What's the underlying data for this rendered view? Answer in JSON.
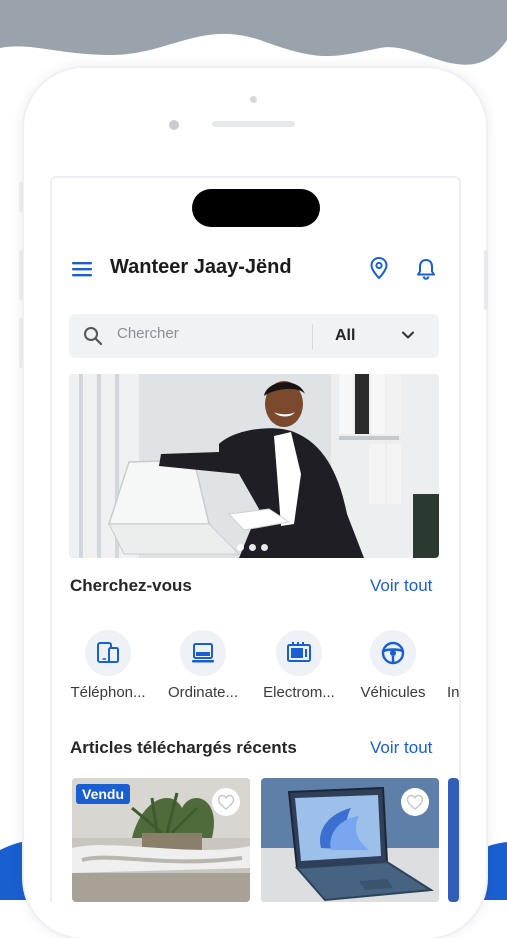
{
  "app": {
    "title": "Wanteer Jaay-Jënd",
    "accent_color": "#1a5fd0"
  },
  "header": {
    "menu_icon": "menu-icon",
    "location_icon": "map-pin-icon",
    "notification_icon": "bell-icon"
  },
  "search": {
    "placeholder": "Chercher",
    "category_select": "All"
  },
  "banner": {
    "slide_count": 3,
    "active_slide": 1
  },
  "categories_section": {
    "title": "Cherchez-vous",
    "link": "Voir tout",
    "items": [
      {
        "label": "Téléphon...",
        "icon": "phone-tablet-icon"
      },
      {
        "label": "Ordinate...",
        "icon": "laptop-icon"
      },
      {
        "label": "Electrom...",
        "icon": "microwave-icon"
      },
      {
        "label": "Véhicules",
        "icon": "steering-wheel-icon"
      },
      {
        "label": "In",
        "icon": ""
      }
    ]
  },
  "recent_section": {
    "title": "Articles téléchargés récents",
    "link": "Voir tout",
    "items": [
      {
        "badge": "Vendu",
        "favorite_icon": "heart-icon"
      },
      {
        "badge": "",
        "favorite_icon": "heart-icon"
      }
    ]
  }
}
